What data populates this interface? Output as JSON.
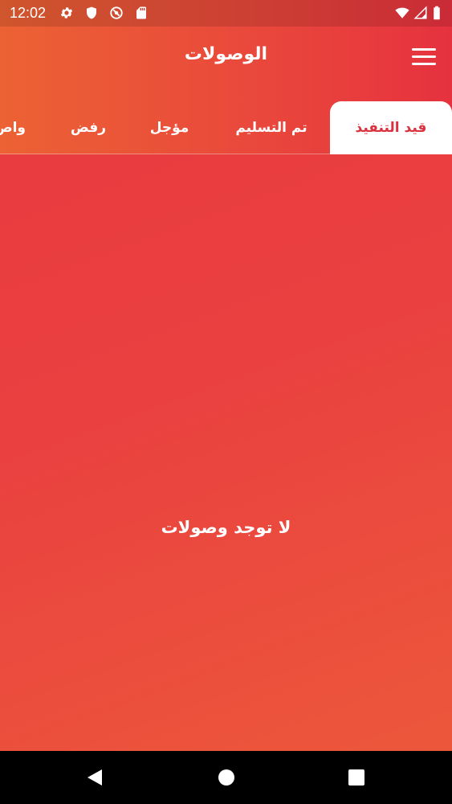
{
  "status_bar": {
    "time": "12:02",
    "icons": [
      "gear-icon",
      "shield-icon",
      "vpn-icon",
      "sd-card-icon",
      "wifi-icon",
      "signal-icon",
      "battery-icon"
    ]
  },
  "app_bar": {
    "title": "الوصولات",
    "menu_icon": "hamburger-menu-icon"
  },
  "tabs": [
    {
      "label": "قيد التنفيذ",
      "active": true
    },
    {
      "label": "تم التسليم",
      "active": false
    },
    {
      "label": "مؤجل",
      "active": false
    },
    {
      "label": "رفض",
      "active": false
    },
    {
      "label": "واص",
      "active": false
    }
  ],
  "content": {
    "empty_message": "لا توجد وصولات"
  },
  "nav_bar": {
    "buttons": [
      "back-icon",
      "home-icon",
      "recents-icon"
    ]
  },
  "colors": {
    "accent": "#d8323f",
    "gradient_start": "#ec6234",
    "gradient_end": "#e6323f"
  }
}
